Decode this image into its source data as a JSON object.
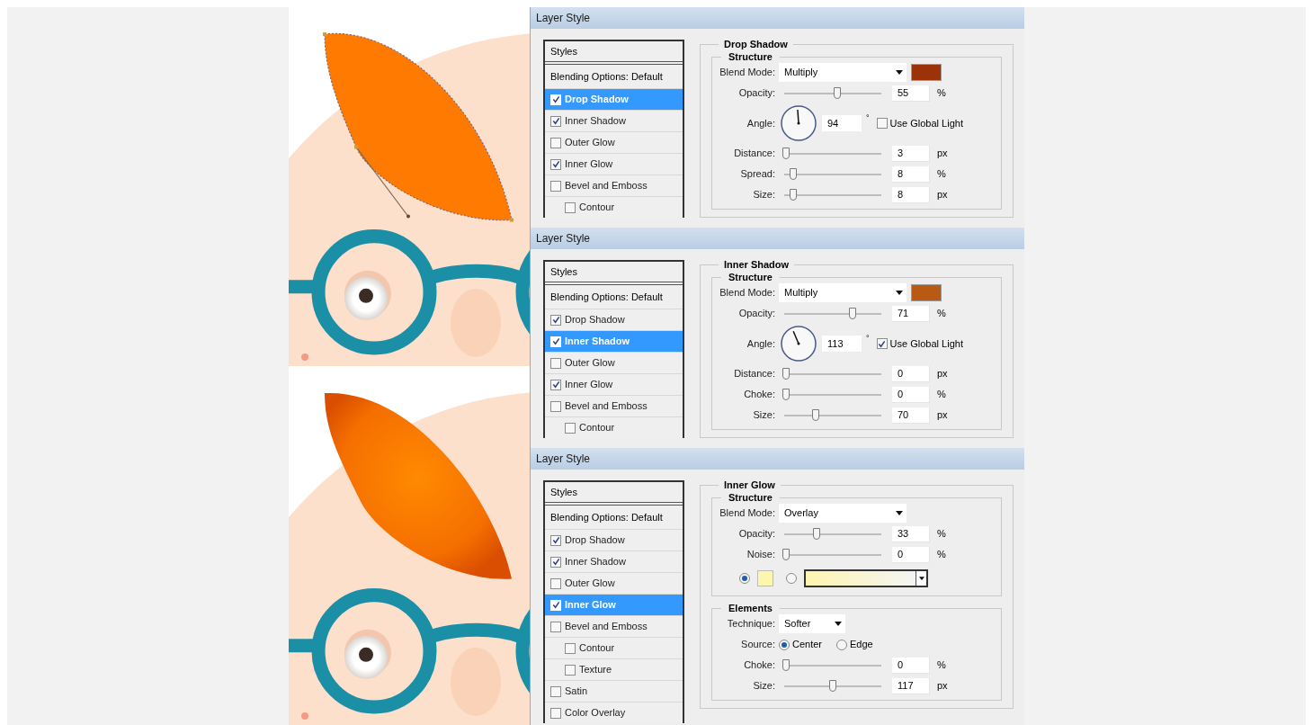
{
  "illustrations": [
    {
      "shaded": false,
      "path_handles": true
    },
    {
      "shaded": true,
      "path_handles": false
    }
  ],
  "dialogs": [
    {
      "title": "Layer Style",
      "list_header": "Styles",
      "blending_options": "Blending Options: Default",
      "style_items": [
        {
          "label": "Drop Shadow",
          "checked": true,
          "selected": true
        },
        {
          "label": "Inner Shadow",
          "checked": true,
          "selected": false
        },
        {
          "label": "Outer Glow",
          "checked": false,
          "selected": false
        },
        {
          "label": "Inner Glow",
          "checked": true,
          "selected": false
        },
        {
          "label": "Bevel and Emboss",
          "checked": false,
          "selected": false,
          "children": [
            {
              "label": "Contour",
              "checked": false,
              "selected": false
            }
          ]
        }
      ],
      "panel": {
        "title": "Drop Shadow",
        "groups": [
          {
            "title": "Structure",
            "rows": [
              {
                "kind": "dropdown",
                "label": "Blend Mode:",
                "value": "Multiply",
                "color": "#9c3208"
              },
              {
                "kind": "slider",
                "label": "Opacity:",
                "level": 0.55,
                "value": "55",
                "unit": "%"
              },
              {
                "kind": "angle",
                "label": "Angle:",
                "value": "94",
                "unit": "°",
                "option": "Use Global Light",
                "checked": false
              },
              {
                "kind": "slider",
                "label": "Distance:",
                "level": 0.0,
                "value": "3",
                "unit": "px"
              },
              {
                "kind": "slider",
                "label": "Spread:",
                "level": 0.08,
                "value": "8",
                "unit": "%"
              },
              {
                "kind": "slider",
                "label": "Size:",
                "level": 0.08,
                "value": "8",
                "unit": "px"
              }
            ]
          }
        ]
      }
    },
    {
      "title": "Layer Style",
      "list_header": "Styles",
      "blending_options": "Blending Options: Default",
      "style_items": [
        {
          "label": "Drop Shadow",
          "checked": true,
          "selected": false
        },
        {
          "label": "Inner Shadow",
          "checked": true,
          "selected": true
        },
        {
          "label": "Outer Glow",
          "checked": false,
          "selected": false
        },
        {
          "label": "Inner Glow",
          "checked": true,
          "selected": false
        },
        {
          "label": "Bevel and Emboss",
          "checked": false,
          "selected": false,
          "children": [
            {
              "label": "Contour",
              "checked": false,
              "selected": false
            }
          ]
        }
      ],
      "panel": {
        "title": "Inner Shadow",
        "groups": [
          {
            "title": "Structure",
            "rows": [
              {
                "kind": "dropdown",
                "label": "Blend Mode:",
                "value": "Multiply",
                "color": "#b85a14"
              },
              {
                "kind": "slider",
                "label": "Opacity:",
                "level": 0.71,
                "value": "71",
                "unit": "%"
              },
              {
                "kind": "angle",
                "label": "Angle:",
                "value": "113",
                "unit": "°",
                "option": "Use Global Light",
                "checked": true
              },
              {
                "kind": "slider",
                "label": "Distance:",
                "level": 0.0,
                "value": "0",
                "unit": "px"
              },
              {
                "kind": "slider",
                "label": "Choke:",
                "level": 0.0,
                "value": "0",
                "unit": "%"
              },
              {
                "kind": "slider",
                "label": "Size:",
                "level": 0.32,
                "value": "70",
                "unit": "px"
              }
            ]
          }
        ]
      }
    },
    {
      "title": "Layer Style",
      "list_header": "Styles",
      "blending_options": "Blending Options: Default",
      "style_items": [
        {
          "label": "Drop Shadow",
          "checked": true,
          "selected": false
        },
        {
          "label": "Inner Shadow",
          "checked": true,
          "selected": false
        },
        {
          "label": "Outer Glow",
          "checked": false,
          "selected": false
        },
        {
          "label": "Inner Glow",
          "checked": true,
          "selected": true
        },
        {
          "label": "Bevel and Emboss",
          "checked": false,
          "selected": false,
          "children": [
            {
              "label": "Contour",
              "checked": false,
              "selected": false
            },
            {
              "label": "Texture",
              "checked": false,
              "selected": false
            }
          ]
        },
        {
          "label": "Satin",
          "checked": false,
          "selected": false
        },
        {
          "label": "Color Overlay",
          "checked": false,
          "selected": false
        }
      ],
      "panel": {
        "title": "Inner Glow",
        "groups": [
          {
            "title": "Structure",
            "rows": [
              {
                "kind": "dropdown",
                "label": "Blend Mode:",
                "value": "Overlay"
              },
              {
                "kind": "slider",
                "label": "Opacity:",
                "level": 0.33,
                "value": "33",
                "unit": "%"
              },
              {
                "kind": "slider",
                "label": "Noise:",
                "level": 0.0,
                "value": "0",
                "unit": "%"
              },
              {
                "kind": "fill",
                "options": [
                  {
                    "kind": "swatch",
                    "selected": true,
                    "color": "#fdf5b0"
                  },
                  {
                    "kind": "gradient",
                    "selected": false,
                    "color": "#fdf5b0"
                  }
                ]
              }
            ]
          },
          {
            "title": "Elements",
            "rows": [
              {
                "kind": "small_dropdown",
                "label": "Technique:",
                "value": "Softer"
              },
              {
                "kind": "radio",
                "label": "Source:",
                "options": [
                  {
                    "label": "Center",
                    "selected": true
                  },
                  {
                    "label": "Edge",
                    "selected": false
                  }
                ]
              },
              {
                "kind": "slider",
                "label": "Choke:",
                "level": 0.0,
                "value": "0",
                "unit": "%"
              },
              {
                "kind": "slider",
                "label": "Size:",
                "level": 0.5,
                "value": "117",
                "unit": "px"
              }
            ]
          }
        ]
      }
    }
  ]
}
